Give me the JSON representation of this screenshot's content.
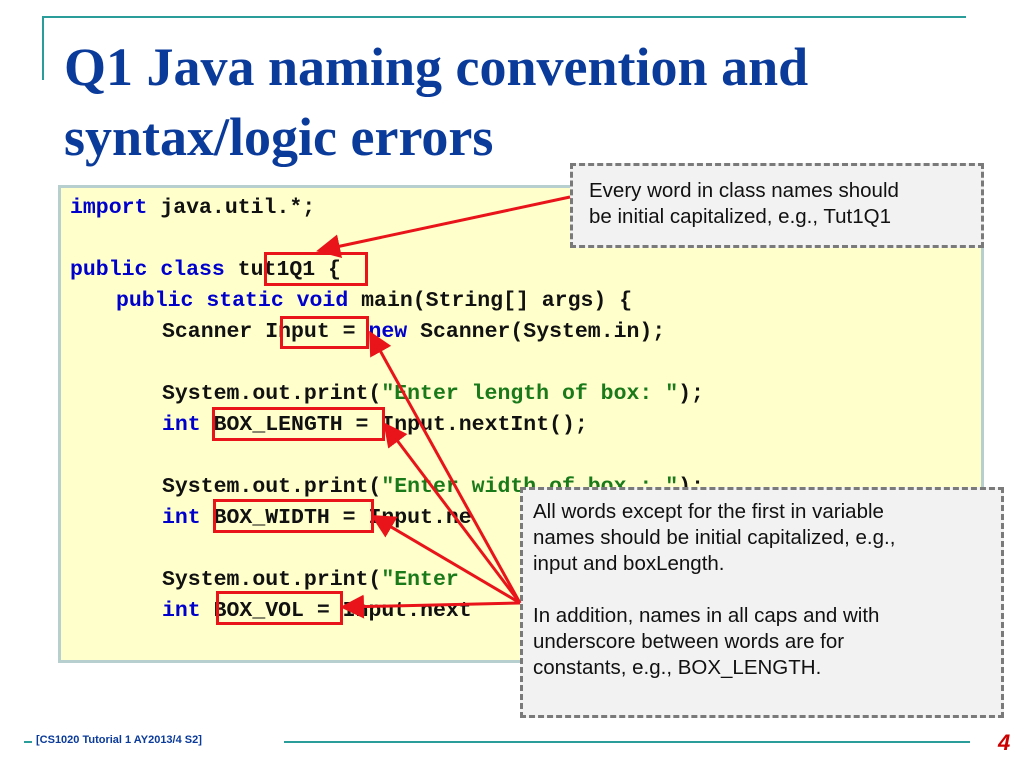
{
  "slide": {
    "title_line1": "Q1 Java naming convention and",
    "title_line2": "syntax/logic errors",
    "footer": "[CS1020 Tutorial 1 AY2013/4 S2]",
    "page_number": "4"
  },
  "code": {
    "l1_kw": "import",
    "l1_rest": " java.util.*;",
    "l2_kw": "public class",
    "l2_name": "tut1Q1",
    "l2_rest": " {",
    "l3_kw": "public static void",
    "l3_rest": " main(String[] args) {",
    "l4_a": "Scanner ",
    "l4_name": "Input",
    "l4_b": " = ",
    "l4_kw": "new",
    "l4_c": " Scanner(System.in);",
    "l5_a": "System.out.print(",
    "l5_str": "\"Enter length of box: \"",
    "l5_b": ");",
    "l6_kw": "int",
    "l6_name": "BOX_LENGTH",
    "l6_rest": " = Input.nextInt();",
    "l7_a": "System.out.print(",
    "l7_str": "\"Enter width of box : \"",
    "l7_b": ");",
    "l8_kw": "int",
    "l8_name": "BOX_WIDTH",
    "l8_rest": " = Input.ne",
    "l9_a": "System.out.print(",
    "l9_str": "\"Enter",
    "l10_kw": "int",
    "l10_name": "BOX_VOL",
    "l10_rest": " = Input.next"
  },
  "callouts": {
    "class_line1": "Every word in class names should",
    "class_line2": "be initial capitalized, e.g., Tut1Q1",
    "var_line1": "All words except for the first in variable",
    "var_line2": "names should be initial capitalized, e.g.,",
    "var_line3": "input and boxLength.",
    "var_line4": "In addition, names in all caps and with",
    "var_line5": "underscore between words are for",
    "var_line6": "constants, e.g., BOX_LENGTH."
  },
  "colors": {
    "title": "#0a3a9a",
    "accent": "#2a9d9a",
    "error": "#e8141a",
    "code_bg": "#ffffcc"
  }
}
